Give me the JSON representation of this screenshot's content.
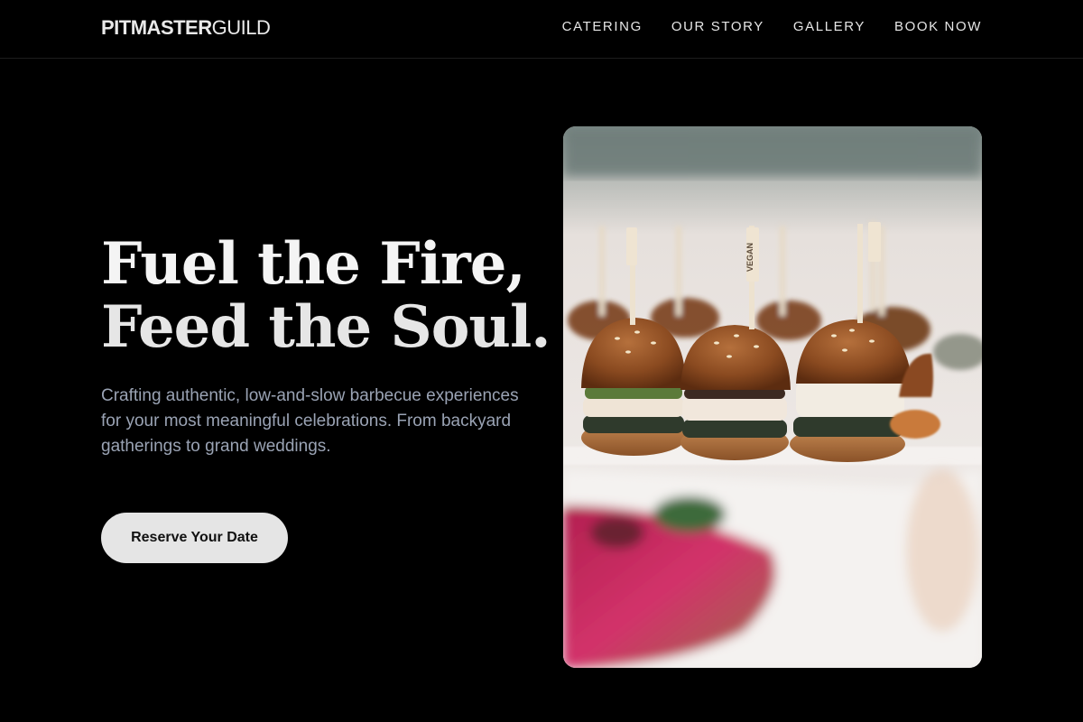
{
  "brand": {
    "bold": "PITMASTER",
    "light": "GUILD"
  },
  "nav": [
    {
      "label": "CATERING"
    },
    {
      "label": "OUR STORY"
    },
    {
      "label": "GALLERY"
    },
    {
      "label": "BOOK NOW"
    }
  ],
  "hero": {
    "line1": "Fuel the Fire,",
    "line2": "Feed the Soul.",
    "subtext": "Crafting authentic, low-and-slow barbecue experiences for your most meaningful celebrations. From backyard gatherings to grand weddings.",
    "cta": "Reserve Your Date"
  },
  "photo": {
    "pick_label": "VEGAN"
  }
}
